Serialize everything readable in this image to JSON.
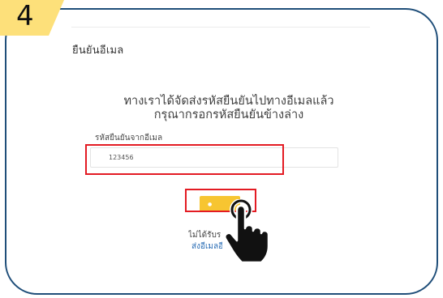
{
  "step": {
    "number": "4"
  },
  "page": {
    "title": "ยืนยันอีเมล"
  },
  "instructions": {
    "line1": "ทางเราได้จัดส่งรหัสยืนยันไปทางอีเมลแล้ว",
    "line2": "กรุณากรอกรหัสยืนยันข้างล่าง"
  },
  "code_field": {
    "label": "รหัสยืนยันจากอีเมล",
    "value": "123456"
  },
  "resend": {
    "text": "ไม่ได้รับรหัส",
    "link": "ส่งอีเมลอีกครั้ง"
  },
  "colors": {
    "frame_border": "#1f4e79",
    "badge": "#fde07a",
    "button": "#f7c531",
    "highlight": "#e31b23",
    "link": "#2a6db5"
  },
  "icons": {
    "pointer": "hand-cursor-icon"
  }
}
